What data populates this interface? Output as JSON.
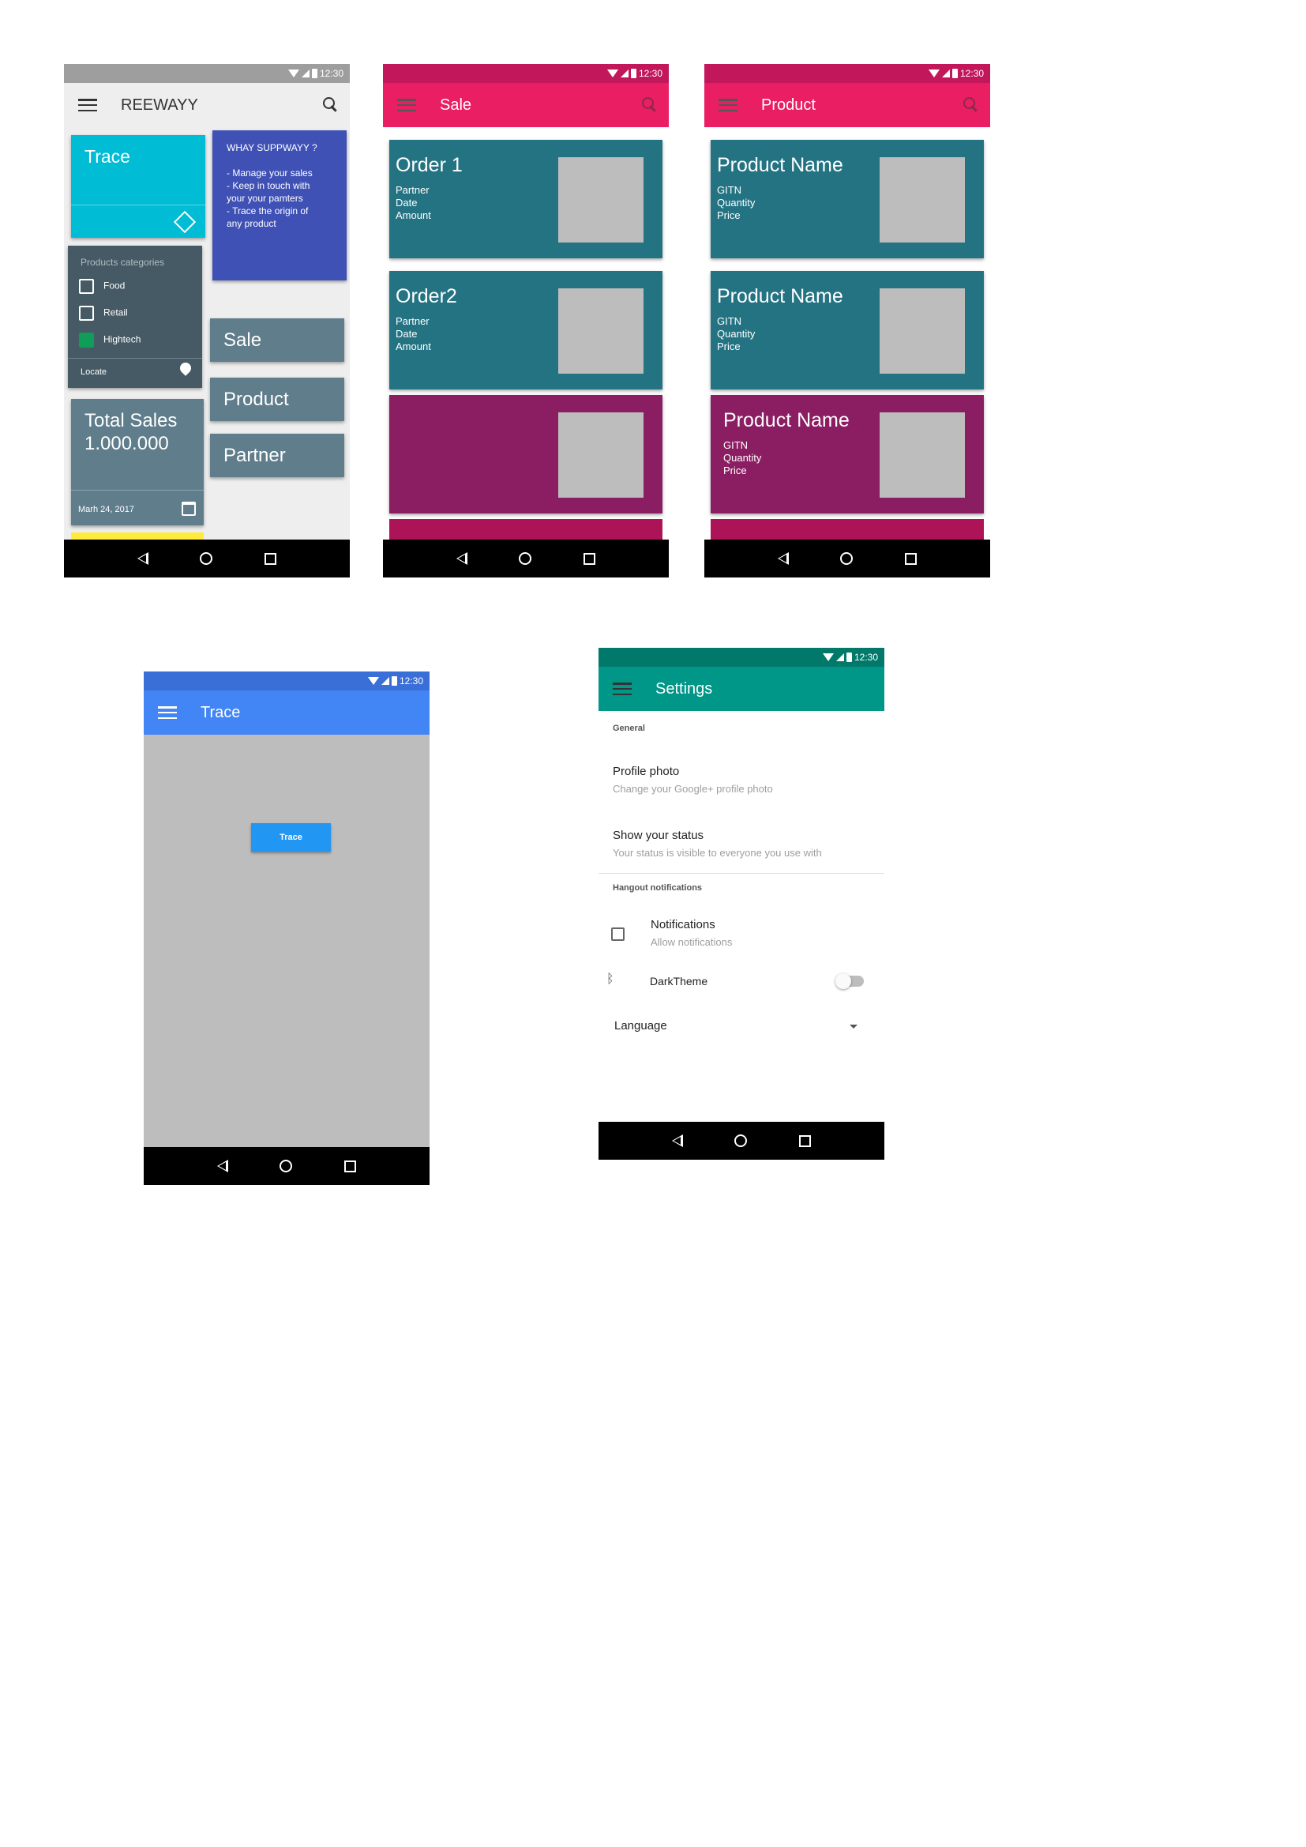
{
  "status_time": "12:30",
  "home": {
    "title": "REEWAYY",
    "trace_tile": "Trace",
    "why": {
      "heading": "WHAY SUPPWAYY ?",
      "lines": [
        "- Manage your sales",
        "- Keep in touch with",
        "your your pamters",
        "- Trace the origin of",
        "any product"
      ]
    },
    "categories": {
      "header": "Products categories",
      "items": [
        {
          "label": "Food",
          "checked": false
        },
        {
          "label": "Retail",
          "checked": false
        },
        {
          "label": "Hightech",
          "checked": true
        }
      ],
      "locate": "Locate"
    },
    "buttons": {
      "sale": "Sale",
      "product": "Product",
      "partner": "Partner"
    },
    "sales": {
      "line1": "Total Sales",
      "line2": "1.000.000",
      "date": "Marh 24, 2017"
    }
  },
  "sale": {
    "title": "Sale",
    "orders": [
      {
        "title": "Order 1",
        "l1": "Partner",
        "l2": "Date",
        "l3": "Amount"
      },
      {
        "title": "Order2",
        "l1": "Partner",
        "l2": "Date",
        "l3": "Amount"
      }
    ]
  },
  "product": {
    "title": "Product",
    "items": [
      {
        "title": "Product  Name",
        "l1": "GITN",
        "l2": "Quantity",
        "l3": "Price"
      },
      {
        "title": "Product  Name",
        "l1": "GITN",
        "l2": "Quantity",
        "l3": "Price"
      },
      {
        "title": "Product  Name",
        "l1": "GITN",
        "l2": "Quantity",
        "l3": "Price"
      }
    ]
  },
  "trace": {
    "title": "Trace",
    "button": "Trace"
  },
  "settings": {
    "title": "Settings",
    "general": "General",
    "profile_photo": "Profile photo",
    "profile_photo_sub": "Change your Google+ profile photo",
    "show_status": "Show your status",
    "show_status_sub": "Your status is visible to everyone you use with",
    "hangout": "Hangout notifications",
    "notifications": "Notifications",
    "notifications_sub": "Allow notifications",
    "dark_theme": "DarkTheme",
    "language": "Language"
  },
  "colors": {
    "home_bar": "#eeeeee",
    "trace_tile": "#00bcd4",
    "why_tile": "#3f51b5",
    "categories": "#455a64",
    "blue_grey": "#607d8b",
    "pink": "#e91e63",
    "pink_dark": "#c2185b",
    "teal_card": "#247383",
    "purple_card": "#8b1e62",
    "trace_blue": "#4285f4",
    "trace_btn": "#2196f3",
    "settings_teal": "#009688"
  }
}
